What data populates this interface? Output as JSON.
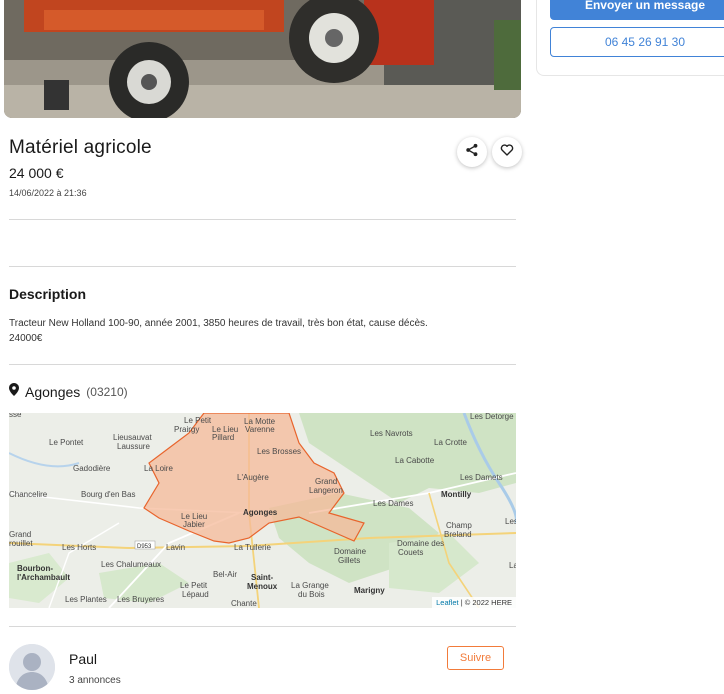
{
  "listing": {
    "title": "Matériel agricole",
    "price": "24 000 €",
    "date": "14/06/2022 à 21:36"
  },
  "contact": {
    "message_label": "Envoyer un message",
    "phone_label": "06 45 26 91 30"
  },
  "actions": {
    "share_icon": "share-icon",
    "favorite_icon": "heart-icon"
  },
  "description": {
    "heading": "Description",
    "text_line1": "Tracteur New Holland 100-90, année 2001, 3850 heures de travail, très bon état, cause décès.",
    "text_line2": "24000€"
  },
  "location": {
    "icon": "map-pin-icon",
    "city": "Agonges",
    "zip": "(03210)"
  },
  "map": {
    "labels": [
      "Les Detorge",
      "Le Petit",
      "Prairgy",
      "La Motte",
      "Varenne",
      "Le Lieu",
      "Pillard",
      "Les Navrots",
      "Le Pontet",
      "Lieusauvat",
      "Laussure",
      "La Crotte",
      "Les Brosses",
      "La Cabotte",
      "Gadodière",
      "La Loire",
      "Les Damets",
      "L'Augère",
      "Grand",
      "Langeron",
      "Montilly",
      "Chancelire",
      "Bourg d'en Bas",
      "Les Dames",
      "Les M",
      "Le Lieu",
      "Jabier",
      "Agonges",
      "Champ",
      "Breland",
      "Grand",
      "Crouillet",
      "D953",
      "Lavin",
      "La Tuilerie",
      "Domaine des",
      "Couets",
      "Les Horts",
      "Domaine",
      "Gillets",
      "Bourbon-",
      "l'Archambault",
      "Les Chalumeaux",
      "Bel-Air",
      "Saint-",
      "Menoux",
      "Le Petit",
      "Lépaud",
      "La Grange",
      "du Bois",
      "Marigny",
      "Les Plantes",
      "Les Bruyeres",
      "Chante",
      "sse",
      "La"
    ],
    "attribution_leaflet": "Leaflet",
    "attribution_sep": " | © 2022 HERE"
  },
  "seller": {
    "name": "Paul",
    "listings_count": "3 annonces",
    "follow_label": "Suivre"
  },
  "colors": {
    "accent_blue": "#4183d7",
    "follow_orange": "#f27b3a",
    "zone_fill": "#f6b99a",
    "zone_stroke": "#e8642c"
  }
}
